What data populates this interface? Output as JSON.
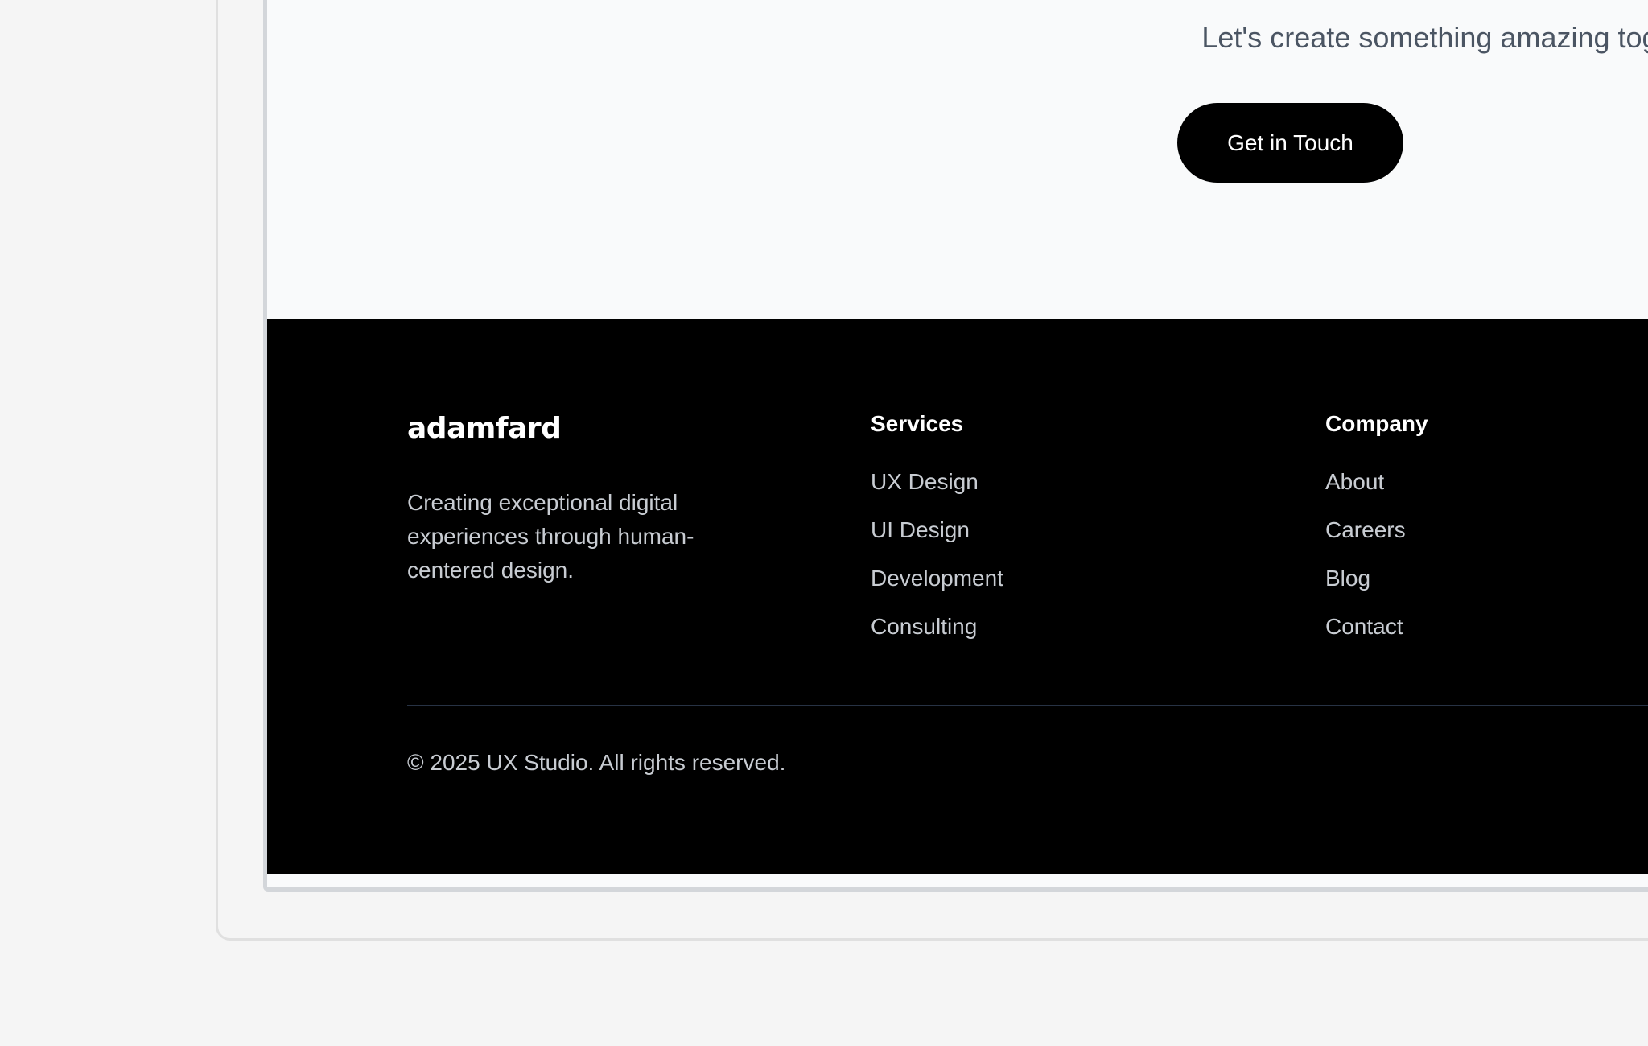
{
  "cta": {
    "subtitle": "Let's create something amazing together.",
    "button_label": "Get in Touch"
  },
  "footer": {
    "brand": {
      "logo_text": "adamfard",
      "description": "Creating exceptional digital experiences through human-centered design."
    },
    "columns": [
      {
        "heading": "Services",
        "links": [
          "UX Design",
          "UI Design",
          "Development",
          "Consulting"
        ]
      },
      {
        "heading": "Company",
        "links": [
          "About",
          "Careers",
          "Blog",
          "Contact"
        ]
      }
    ],
    "copyright": "© 2025 UX Studio. All rights reserved."
  },
  "colors": {
    "page_background": "#f5f5f5",
    "cta_background": "#f9fafb",
    "footer_background": "#000000",
    "button_background": "#000000",
    "button_text": "#ffffff",
    "footer_link": "#c8ccd2",
    "footer_divider": "#273244"
  }
}
